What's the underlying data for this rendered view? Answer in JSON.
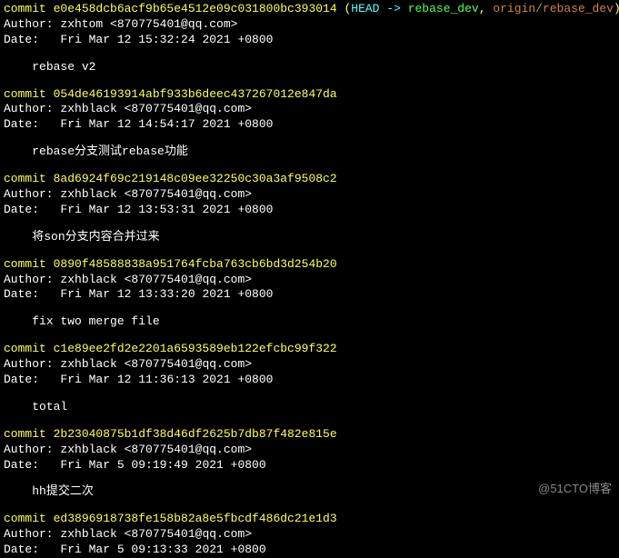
{
  "commits": [
    {
      "hash": "e0e458dcb6acf9b65e4512e09c031800bc393014",
      "refs": {
        "head_label": "HEAD -> ",
        "local_branch": "rebase_dev",
        "separator": ", ",
        "remote_branch": "origin/rebase_dev"
      },
      "author": "zxhtom <870775401@qq.com>",
      "date": "Fri Mar 12 15:32:24 2021 +0800",
      "message": "rebase v2"
    },
    {
      "hash": "054de46193914abf933b6deec437267012e847da",
      "author": "zxhblack <870775401@qq.com>",
      "date": "Fri Mar 12 14:54:17 2021 +0800",
      "message": "rebase分支测试rebase功能"
    },
    {
      "hash": "8ad6924f69c219148c09ee32250c30a3af9508c2",
      "author": "zxhblack <870775401@qq.com>",
      "date": "Fri Mar 12 13:53:31 2021 +0800",
      "message": "将son分支内容合并过来"
    },
    {
      "hash": "0890f48588838a951764fcba763cb6bd3d254b20",
      "author": "zxhblack <870775401@qq.com>",
      "date": "Fri Mar 12 13:33:20 2021 +0800",
      "message": "fix two merge file"
    },
    {
      "hash": "c1e89ee2fd2e2201a6593589eb122efcbc99f322",
      "author": "zxhblack <870775401@qq.com>",
      "date": "Fri Mar 12 11:36:13 2021 +0800",
      "message": "total"
    },
    {
      "hash": "2b23040875b1df38d46df2625b7db87f482e815e",
      "author": "zxhblack <870775401@qq.com>",
      "date": "Fri Mar 5 09:19:49 2021 +0800",
      "message": "hh提交二次"
    },
    {
      "hash": "ed3896918738fe158b82a8e5fbcdf486dc21e1d3",
      "author": "zxhblack <870775401@qq.com>",
      "date": "Fri Mar 5 09:13:33 2021 +0800"
    }
  ],
  "labels": {
    "commit": "commit ",
    "author": "Author: ",
    "date": "Date:   "
  },
  "watermark": "@51CTO博客"
}
